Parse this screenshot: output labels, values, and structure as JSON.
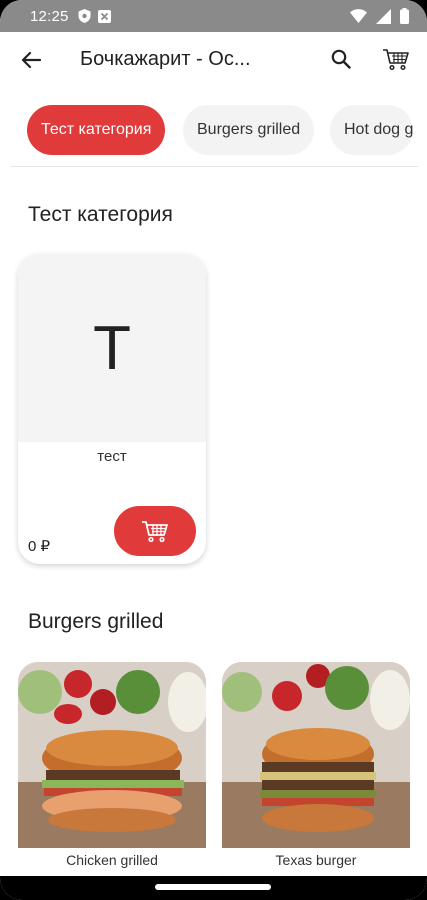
{
  "status_bar": {
    "time": "12:25"
  },
  "app_bar": {
    "title": "Бочкажарит - Ос..."
  },
  "categories": [
    {
      "label": "Тест категория",
      "active": true
    },
    {
      "label": "Burgers grilled",
      "active": false
    },
    {
      "label": "Hot dog g",
      "active": false
    }
  ],
  "sections": [
    {
      "title": "Тест категория",
      "items": [
        {
          "placeholder_letter": "Т",
          "name": "тест",
          "price": "0 ₽"
        }
      ]
    },
    {
      "title": "Burgers grilled",
      "items": [
        {
          "name": "Chicken grilled"
        },
        {
          "name": "Texas burger"
        }
      ]
    }
  ],
  "colors": {
    "accent": "#e03a3a",
    "chip_bg": "#f3f3f3",
    "status_bar": "#8a8a8a"
  }
}
